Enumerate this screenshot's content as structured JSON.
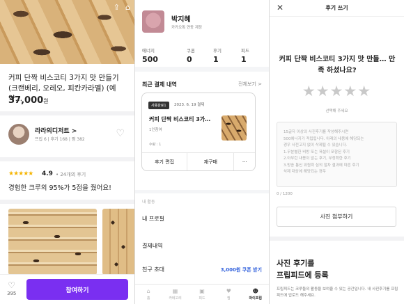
{
  "product_page": {
    "share_icon": "share-icon",
    "home_icon": "home-icon",
    "title": "커피 단짝 비스코티 3가지 맛 만들기 (크랜베리, 오레오, 피칸카라멜) (예약…",
    "price": "37,000",
    "price_unit": "원",
    "host": {
      "name": "라라의디저트 >",
      "stats": "프립 6 | 후기 168 | 찜 382"
    },
    "rating": {
      "stars": "★★★★★",
      "score": "4.9",
      "count": "• 24개의 후기"
    },
    "rating_desc": "경험한 크루의 95%가 5점을 줬어요!",
    "like_count": "395",
    "join_label": "참여하기"
  },
  "mypage": {
    "name": "박지혜",
    "account": "카카오톡 연동 계정",
    "stats": [
      {
        "label": "에너지",
        "value": "500"
      },
      {
        "label": "쿠폰",
        "value": "0"
      },
      {
        "label": "후기",
        "value": "1"
      },
      {
        "label": "피드",
        "value": "1"
      }
    ],
    "recent_title": "최근 결제 내역",
    "see_all": "전체보기 >",
    "order": {
      "badge": "사용완료1",
      "date": "2023. 6. 19 결제",
      "title": "커피 단짝 비스코티 3가…",
      "option": "1인참여",
      "qty": "수량 : 1",
      "actions": [
        "후기 편집",
        "재구매",
        "···"
      ]
    },
    "menu_head": "내 활동",
    "menu": [
      "내 프로필",
      "결제내역",
      "친구 초대"
    ],
    "coupon_text": "3,000원 쿠폰 받기",
    "tabs": [
      {
        "label": "홈",
        "active": false
      },
      {
        "label": "카테고리",
        "active": false
      },
      {
        "label": "피드",
        "active": false
      },
      {
        "label": "찜",
        "active": false
      },
      {
        "label": "마이프립",
        "active": true
      }
    ]
  },
  "review": {
    "close_icon": "close-icon",
    "header": "후기 쓰기",
    "question": "커피 단짝 비스코티 3가지 맛 만들… 만족 하셨나요?",
    "stars": "★★★★★",
    "select_hint": "선택해 주세요",
    "placeholder": [
      "15글자 이상의 사진후기를 작성해주시면",
      "500에너지가 적립됩니다. 아래의 내용에 해당되는",
      "경우 사전고지 없이 삭제될 수 있습니다.",
      "1.무분별한 비방 또는 욕설이 포함된 후기",
      "2.아무런 내용이 없는 후기, 부정확한 후기",
      "3.방송 통신 위원회 심의 절차 결과에 따른 후기",
      "삭제 대상에 해당되는 경우"
    ],
    "counter": "0 / 1200",
    "attach_label": "사진 첨부하기",
    "feed_title_1": "사진 후기를",
    "feed_title_2": "프립피드에 등록",
    "feed_desc": "프립피드는 크루들의 활동을 보여줄 수 있는 공간입니다. 내 사진후기를 프립피드에 업로드 해주세요."
  }
}
